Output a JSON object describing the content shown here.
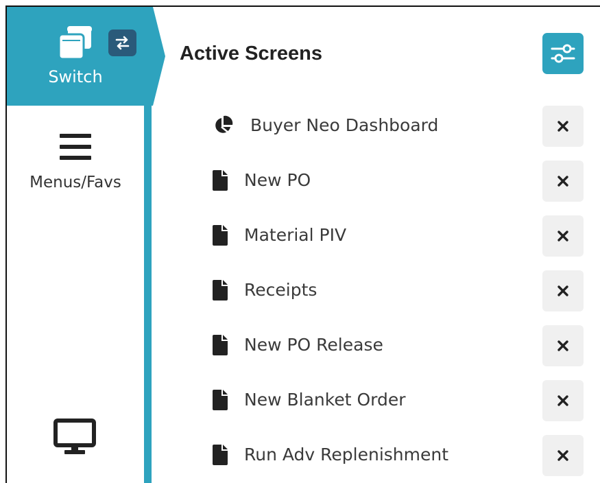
{
  "sidebar": {
    "switch_label": "Switch",
    "menus_label": "Menus/Favs",
    "accent_color": "#2ea3be",
    "badge_color": "#2a5a7a"
  },
  "panel": {
    "title": "Active Screens",
    "filter_icon": "sliders-icon"
  },
  "screens": [
    {
      "label": "Buyer Neo Dashboard",
      "icon": "pie-chart-icon"
    },
    {
      "label": "New PO",
      "icon": "document-icon"
    },
    {
      "label": "Material PIV",
      "icon": "document-icon"
    },
    {
      "label": "Receipts",
      "icon": "document-icon"
    },
    {
      "label": "New PO Release",
      "icon": "document-icon"
    },
    {
      "label": "New Blanket Order",
      "icon": "document-icon"
    },
    {
      "label": "Run Adv Replenishment",
      "icon": "document-icon"
    }
  ]
}
